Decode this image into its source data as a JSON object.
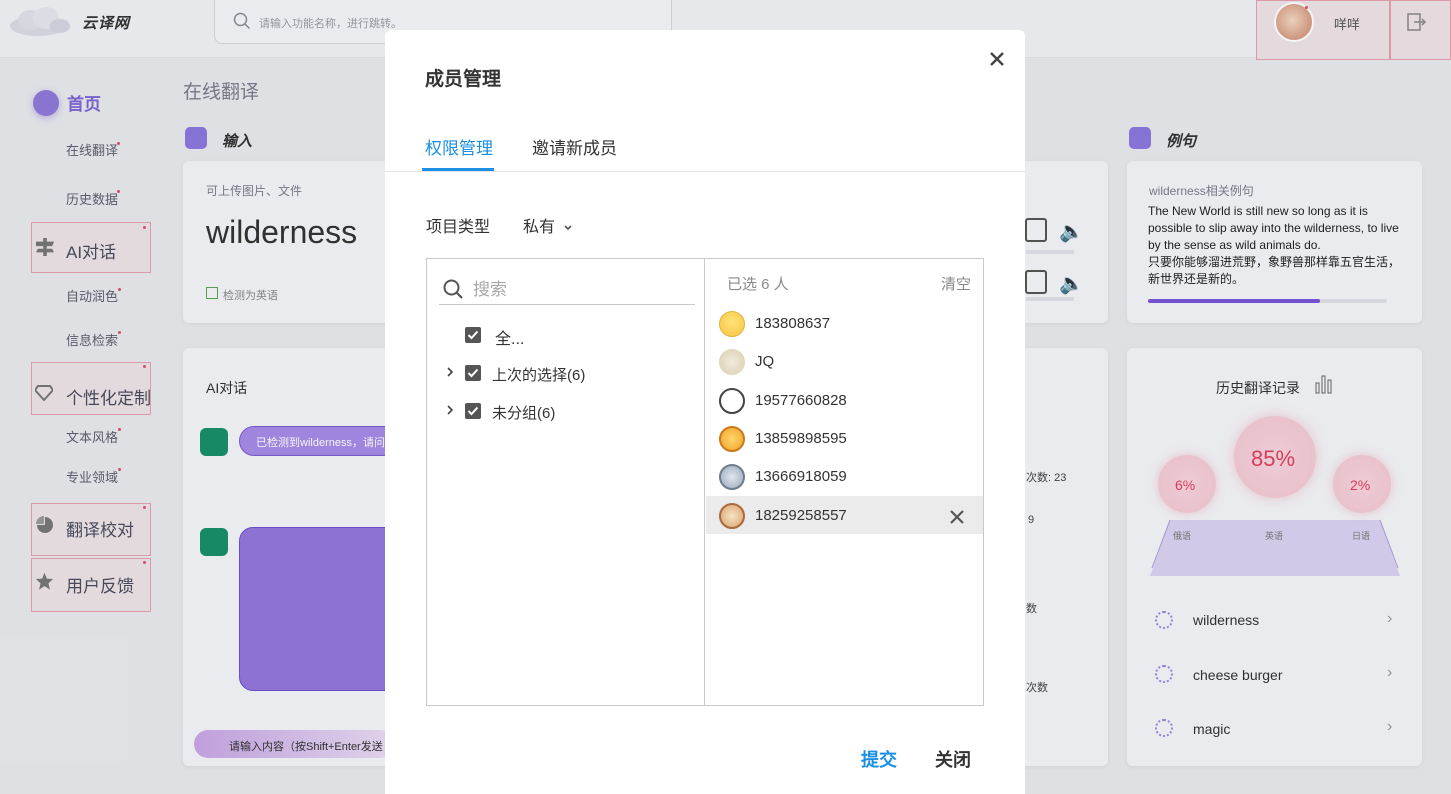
{
  "app": {
    "name": "云译网"
  },
  "header": {
    "search_placeholder": "请输入功能名称，进行跳转。",
    "user_name": "咩咩"
  },
  "sidebar": {
    "items": [
      {
        "label": "首页"
      },
      {
        "label": "在线翻译"
      },
      {
        "label": "历史数据"
      },
      {
        "label": "AI对话"
      },
      {
        "label": "自动润色"
      },
      {
        "label": "信息检索"
      },
      {
        "label": "个性化定制"
      },
      {
        "label": "文本风格"
      },
      {
        "label": "专业领域"
      },
      {
        "label": "翻译校对"
      },
      {
        "label": "用户反馈"
      }
    ]
  },
  "main": {
    "page_title": "在线翻译",
    "input_section_title": "输入",
    "input_hint": "可上传图片、文件",
    "input_text": "wilderness",
    "detect_label": "检测为英语",
    "ai_chat_title": "AI对话",
    "ai_bubble_text": "已检测到wilderness，请问",
    "chat_input_placeholder": "请输入内容（按Shift+Enter发送",
    "stats_fragments": [
      "次数: 23",
      "9",
      "数",
      "次数"
    ],
    "example_section_title": "例句",
    "example_card_title": "wilderness相关例句",
    "example_en": "The New World is still new so long as it is possible to slip away into the wilderness, to live by the sense as wild animals do.",
    "example_zh": "只要你能够溜进荒野，象野兽那样靠五官生活，新世界还是新的。",
    "example_progress": 0.72,
    "history_title": "历史翻译记录",
    "bubbles": [
      {
        "pct": "6%",
        "label": "俄语"
      },
      {
        "pct": "85%",
        "label": "英语"
      },
      {
        "pct": "2%",
        "label": "日语"
      }
    ],
    "history_items": [
      {
        "text": "wilderness"
      },
      {
        "text": "cheese burger"
      },
      {
        "text": "magic"
      }
    ]
  },
  "dialog": {
    "title": "成员管理",
    "tabs": [
      {
        "label": "权限管理"
      },
      {
        "label": "邀请新成员"
      }
    ],
    "project_type_label": "项目类型",
    "project_type_value": "私有",
    "search_placeholder": "搜索",
    "tree": [
      {
        "label": "全..."
      },
      {
        "label": "上次的选择(6)"
      },
      {
        "label": "未分组(6)"
      }
    ],
    "selected_count": "已选 6 人",
    "clear_label": "清空",
    "members": [
      {
        "name": "183808637"
      },
      {
        "name": "JQ"
      },
      {
        "name": "19577660828"
      },
      {
        "name": "13859898595"
      },
      {
        "name": "13666918059"
      },
      {
        "name": "18259258557"
      }
    ],
    "submit_label": "提交",
    "close_label": "关闭"
  }
}
